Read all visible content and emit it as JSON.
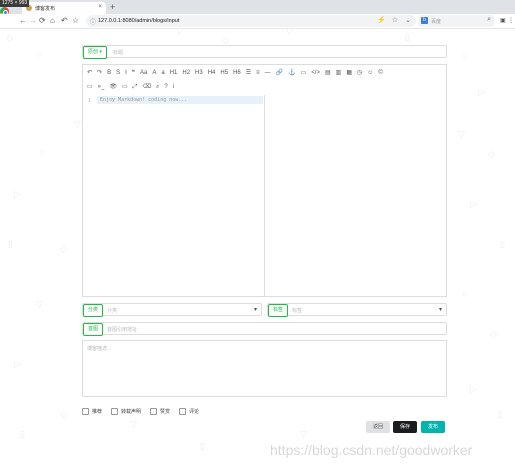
{
  "window": {
    "size_label": "1275 × 993"
  },
  "browser": {
    "tab_title": "博客发布",
    "tab_close": "×",
    "new_tab": "+",
    "url": "127.0.0.1:8080/admin/blogs/input",
    "search_engine": "百度"
  },
  "form": {
    "type_dropdown": "原创",
    "title_placeholder": "标题",
    "editor_placeholder": "Enjoy Markdown! coding now...",
    "line_number": "1",
    "category_label": "分类",
    "category_placeholder": "分类",
    "tag_label": "标签",
    "tag_placeholder": "标签",
    "firstpic_label": "首图",
    "firstpic_placeholder": "首图引用地址",
    "description_placeholder": "博客描述...",
    "options": [
      "推荐",
      "转载声明",
      "赞赏",
      "评论"
    ],
    "back_button": "返回",
    "save_button": "保存",
    "publish_button": "发布"
  },
  "toolbar": {
    "row1": [
      "undo-icon",
      "redo-icon",
      "bold-icon",
      "strikethrough-icon",
      "italic-icon",
      "quote-icon",
      "uppercase-icon",
      "title-case-icon",
      "lowercase-icon",
      "h1",
      "h2",
      "h3",
      "h4",
      "h5",
      "h6",
      "unordered-list-icon",
      "ordered-list-icon",
      "hr-icon",
      "link-icon",
      "anchor-icon",
      "image-icon",
      "code-icon",
      "code-block-icon",
      "preformatted-icon",
      "table-icon",
      "datetime-icon",
      "emoji-icon",
      "html-entity-icon"
    ],
    "row1_text": [
      "↶",
      "↷",
      "B",
      "S",
      "I",
      "❝",
      "Aa",
      "A",
      "a",
      "H1",
      "H2",
      "H3",
      "H4",
      "H5",
      "H6",
      "☰",
      "≡",
      "—",
      "🔗",
      "⚓",
      "▭",
      "</>",
      "▤",
      "▥",
      "▦",
      "◷",
      "☺",
      "©"
    ],
    "row2": [
      "pagebreak-icon",
      "goto-line-icon",
      "watch-icon",
      "preview-icon",
      "fullscreen-icon",
      "clear-icon",
      "search-icon",
      "help-icon",
      "info-icon"
    ],
    "row2_text": [
      "▭",
      "»_",
      "👁",
      "▭",
      "⤢",
      "⌫",
      "⌕",
      "?",
      "i"
    ]
  },
  "watermark": "https://blog.csdn.net/goodworker",
  "colors": {
    "teal": "#21ba45",
    "save": "#1b1c1d",
    "publish": "#00b5ad",
    "back": "#e0e1e2"
  }
}
